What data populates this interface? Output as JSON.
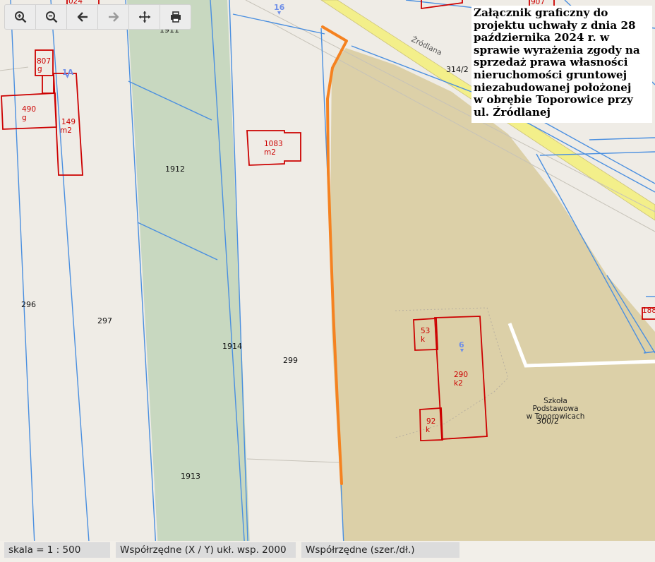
{
  "toolbar": {
    "buttons": [
      {
        "name": "zoom-in",
        "icon": "zoom-in-icon"
      },
      {
        "name": "zoom-out",
        "icon": "zoom-out-icon"
      },
      {
        "name": "back",
        "icon": "arrow-left-icon"
      },
      {
        "name": "forward",
        "icon": "arrow-right-icon",
        "disabled": true
      },
      {
        "name": "pan",
        "icon": "move-icon"
      },
      {
        "name": "print",
        "icon": "print-icon"
      }
    ]
  },
  "title": {
    "lines": [
      "Załącznik graficzny do",
      "projektu uchwały z dnia  28",
      "października 2024 r. w",
      "sprawie wyrażenia zgody na",
      "sprzedaż prawa własności",
      "nieruchomości gruntowej",
      "niezabudowanej położonej",
      "w obrębie Toporowice przy",
      "ul. Źródlanej"
    ]
  },
  "map": {
    "street_name": "Źródlana",
    "parcels": {
      "p1911": "1911",
      "p1912": "1912",
      "p1913": "1913",
      "p1914": "1914",
      "p296": "296",
      "p297": "297",
      "p299": "299",
      "p314_2": "314/2",
      "p300_2": "300/2",
      "p188": "188"
    },
    "buildings": {
      "b807": [
        "807",
        "g"
      ],
      "b490": [
        "490",
        "g"
      ],
      "b149": [
        "149",
        "m2"
      ],
      "b1083": [
        "1083",
        "m2"
      ],
      "b53": [
        "53",
        "k"
      ],
      "b290": [
        "290",
        "k2"
      ],
      "b92": [
        "92",
        "k"
      ],
      "b907": "907",
      "b024": "024"
    },
    "address_numbers": {
      "a16": "16",
      "a1a": "1A",
      "a6": "6"
    },
    "school_label": [
      "Szkoła",
      "Podstawowa",
      "w Toporowicach"
    ],
    "colors": {
      "boundary": "#4a8fe0",
      "building": "#cc0000",
      "selected_plot": "#f58220",
      "road": "#f3ef8a",
      "school_area": "#dcd0a8",
      "green_strip": "#c8d8c0",
      "background": "#efece6"
    }
  },
  "status": {
    "scale": "skala = 1 : 500",
    "coords_2000": "Współrzędne (X / Y) ukł. wsp. 2000",
    "coords_geo": "Współrzędne (szer./dł.)"
  }
}
